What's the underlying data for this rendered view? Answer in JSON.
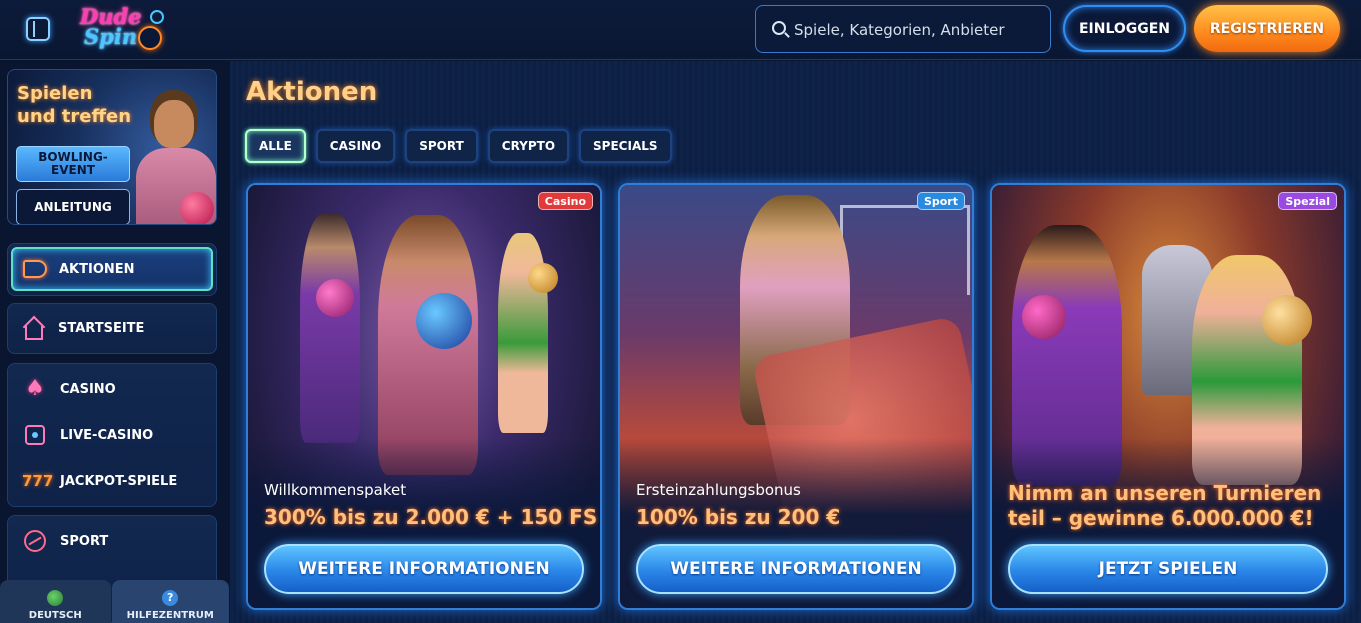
{
  "header": {
    "logo_line1": "Dude",
    "logo_line2": "Spin",
    "search_placeholder": "Spiele, Kategorien, Anbieter",
    "login_label": "EINLOGGEN",
    "register_label": "REGISTRIEREN"
  },
  "sidebar": {
    "promo": {
      "title": "Spielen und treffen",
      "event_button": "BOWLING-EVENT",
      "guide_button": "ANLEITUNG"
    },
    "nav_active": {
      "label": "AKTIONEN",
      "icon": "megaphone-icon"
    },
    "nav_home": {
      "label": "STARTSEITE",
      "icon": "home-icon"
    },
    "nav_games": [
      {
        "label": "CASINO",
        "icon": "spade-icon"
      },
      {
        "label": "LIVE-CASINO",
        "icon": "dice-icon"
      },
      {
        "label": "JACKPOT-SPIELE",
        "icon": "777-icon"
      }
    ],
    "nav_sport": {
      "label": "SPORT",
      "icon": "volleyball-icon"
    },
    "footer": {
      "language_label": "DEUTSCH",
      "help_label": "HILFEZENTRUM"
    }
  },
  "main": {
    "title": "Aktionen",
    "tabs": [
      {
        "label": "ALLE",
        "active": true
      },
      {
        "label": "CASINO",
        "active": false
      },
      {
        "label": "SPORT",
        "active": false
      },
      {
        "label": "CRYPTO",
        "active": false
      },
      {
        "label": "SPECIALS",
        "active": false
      }
    ],
    "cards": [
      {
        "badge": "Casino",
        "subtitle": "Willkommenspaket",
        "headline": "300% bis zu 2.000 € + 150 FS",
        "cta": "WEITERE INFORMATIONEN"
      },
      {
        "badge": "Sport",
        "subtitle": "Ersteinzahlungsbonus",
        "headline": "100% bis zu 200 €",
        "cta": "WEITERE INFORMATIONEN"
      },
      {
        "badge": "Spezial",
        "headline": "Nimm an unseren Turnieren teil – gewinne 6.000.000 €!",
        "cta": "JETZT SPIELEN"
      }
    ]
  },
  "colors": {
    "background": "#0a1630",
    "accent_orange": "#ff8a1e",
    "accent_blue": "#2a86e8",
    "title_gold": "#ffd08a"
  }
}
